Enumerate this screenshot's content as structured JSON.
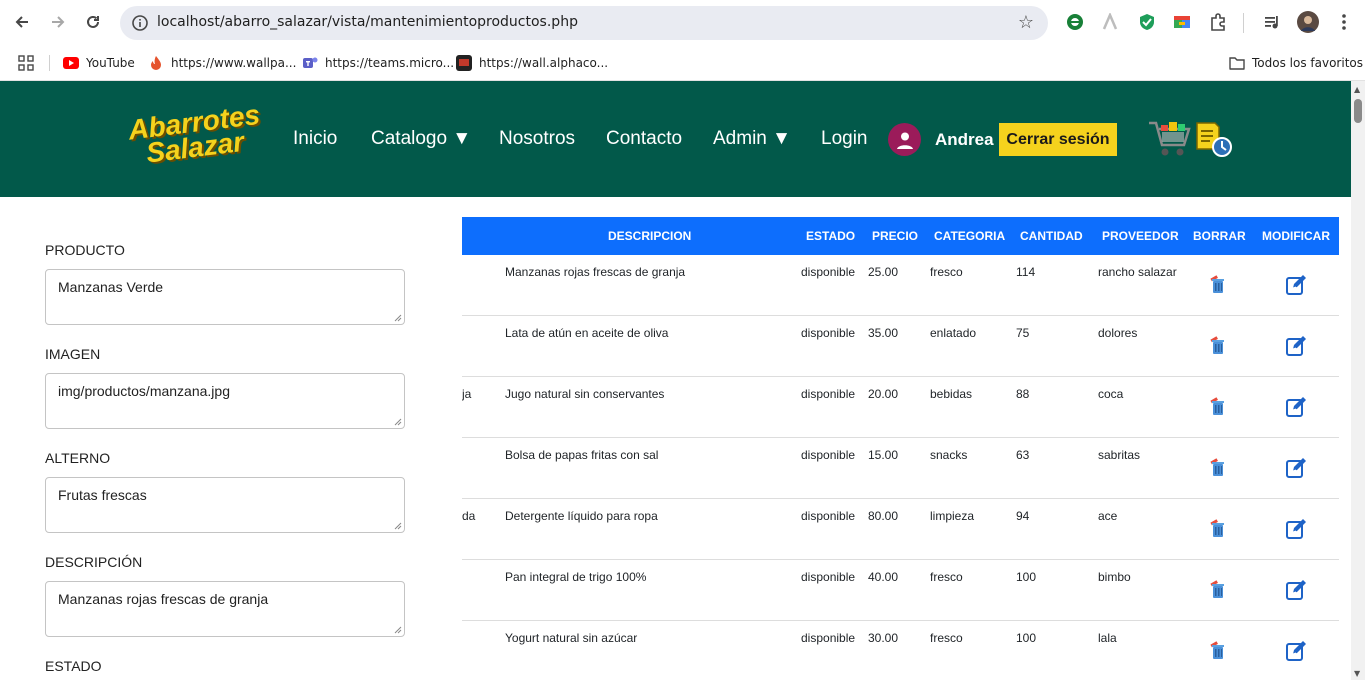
{
  "browser": {
    "url": "localhost/abarro_salazar/vista/mantenimientoproductos.php",
    "bookmarks": [
      {
        "label": "YouTube",
        "icon": "youtube-icon",
        "color": "#ff0000"
      },
      {
        "label": "https://www.wallpa...",
        "icon": "flame-icon",
        "color": "#e5532d"
      },
      {
        "label": "https://teams.micro...",
        "icon": "teams-icon",
        "color": "#5b5fc7"
      },
      {
        "label": "https://wall.alphaco...",
        "icon": "alphacoders-icon",
        "color": "#222222"
      }
    ],
    "all_bookmarks_label": "Todos los favoritos"
  },
  "site": {
    "logo_line1": "Abarrotes",
    "logo_line2": "Salazar",
    "menu": [
      {
        "label": "Inicio"
      },
      {
        "label": "Catalogo ▼"
      },
      {
        "label": "Nosotros"
      },
      {
        "label": "Contacto"
      },
      {
        "label": "Admin ▼"
      },
      {
        "label": "Login"
      }
    ],
    "username": "Andrea",
    "logout_label": "Cerrar sesión",
    "colors": {
      "header_bg": "#02594a",
      "accent": "#f5d21d",
      "table_header": "#0d6efd"
    }
  },
  "form": {
    "fields": [
      {
        "label": "PRODUCTO",
        "value": "Manzanas Verde"
      },
      {
        "label": "IMAGEN",
        "value": "img/productos/manzana.jpg"
      },
      {
        "label": "ALTERNO",
        "value": "Frutas frescas"
      },
      {
        "label": "DESCRIPCIÓN",
        "value": "Manzanas rojas frescas de granja"
      }
    ],
    "next_label": "ESTADO"
  },
  "table": {
    "headers": [
      "DESCRIPCION",
      "ESTADO",
      "PRECIO",
      "CATEGORIA",
      "CANTIDAD",
      "PROVEEDOR",
      "BORRAR",
      "MODIFICAR"
    ],
    "rows": [
      {
        "clip": "",
        "descripcion": "Manzanas rojas frescas de granja",
        "estado": "disponible",
        "precio": "25.00",
        "categoria": "fresco",
        "cantidad": "114",
        "proveedor": "rancho salazar"
      },
      {
        "clip": "",
        "descripcion": "Lata de atún en aceite de oliva",
        "estado": "disponible",
        "precio": "35.00",
        "categoria": "enlatado",
        "cantidad": "75",
        "proveedor": "dolores"
      },
      {
        "clip": "ja",
        "descripcion": "Jugo natural sin conservantes",
        "estado": "disponible",
        "precio": "20.00",
        "categoria": "bebidas",
        "cantidad": "88",
        "proveedor": "coca"
      },
      {
        "clip": "",
        "descripcion": "Bolsa de papas fritas con sal",
        "estado": "disponible",
        "precio": "15.00",
        "categoria": "snacks",
        "cantidad": "63",
        "proveedor": "sabritas"
      },
      {
        "clip": "da",
        "descripcion": "Detergente líquido para ropa",
        "estado": "disponible",
        "precio": "80.00",
        "categoria": "limpieza",
        "cantidad": "94",
        "proveedor": "ace"
      },
      {
        "clip": "",
        "descripcion": "Pan integral de trigo 100%",
        "estado": "disponible",
        "precio": "40.00",
        "categoria": "fresco",
        "cantidad": "100",
        "proveedor": "bimbo"
      },
      {
        "clip": "",
        "descripcion": "Yogurt natural sin azúcar",
        "estado": "disponible",
        "precio": "30.00",
        "categoria": "fresco",
        "cantidad": "100",
        "proveedor": "lala"
      }
    ]
  }
}
